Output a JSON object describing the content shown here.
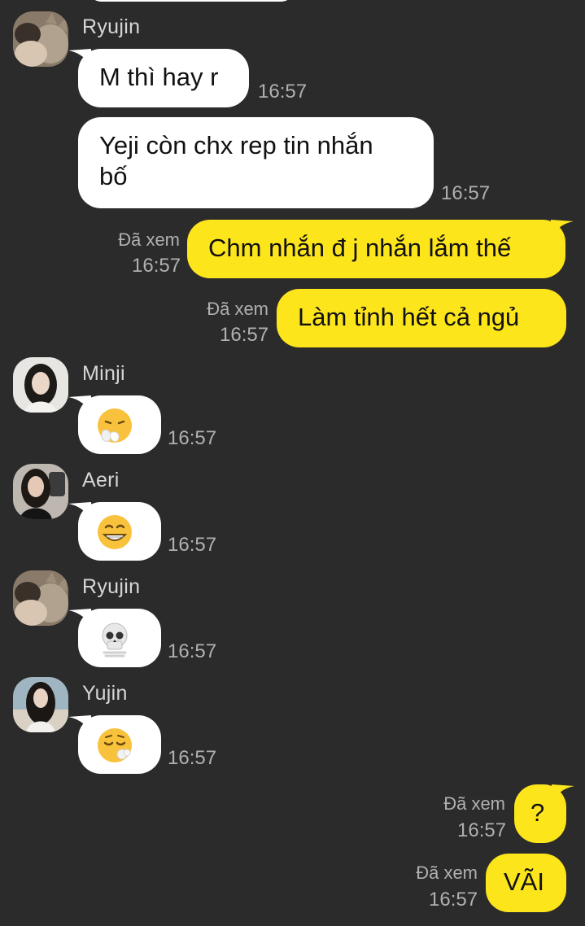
{
  "messages": [
    {
      "sender": "Ryujin",
      "text": "M thì hay r",
      "time": "16:57"
    },
    {
      "sender": "Ryujin",
      "text": "Yeji còn chx rep tin nhắn\nbố",
      "time": "16:57"
    },
    {
      "sender": "me",
      "text": "Chm nhắn đ j nhắn lắm thế",
      "time": "16:57",
      "read": "Đã xem"
    },
    {
      "sender": "me",
      "text": "Làm tỉnh hết cả ngủ",
      "time": "16:57",
      "read": "Đã xem"
    },
    {
      "sender": "Minji",
      "emoji": "sneezing-face-emoji",
      "time": "16:57"
    },
    {
      "sender": "Aeri",
      "emoji": "grinning-face-emoji",
      "time": "16:57"
    },
    {
      "sender": "Ryujin",
      "emoji": "skull-emoji",
      "time": "16:57"
    },
    {
      "sender": "Yujin",
      "emoji": "face-exhaling-emoji",
      "time": "16:57"
    },
    {
      "sender": "me",
      "text": "?",
      "time": "16:57",
      "read": "Đã xem"
    },
    {
      "sender": "me",
      "text": "VÃI",
      "time": "16:57",
      "read": "Đã xem"
    }
  ],
  "colors": {
    "background": "#2b2b2b",
    "incoming": "#ffffff",
    "outgoing": "#fde51c"
  }
}
